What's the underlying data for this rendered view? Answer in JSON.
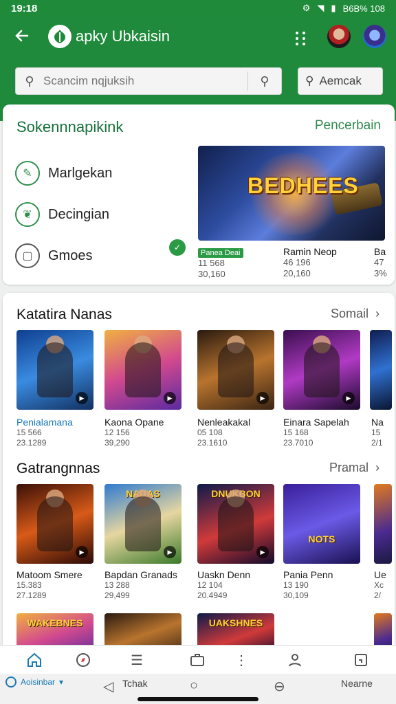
{
  "status": {
    "time": "19:18",
    "right_text": "B6B% 108"
  },
  "header": {
    "title": "apky Ubkaisin"
  },
  "search": {
    "placeholder": "Scancim nqjuksih",
    "secondary_label": "Aemcak"
  },
  "featured": {
    "title": "Sokennnapikink",
    "link": "Pencerbain",
    "categories": [
      {
        "label": "Marlgekan",
        "icon": "pencil-icon"
      },
      {
        "label": "Decingian",
        "icon": "leaf-icon"
      },
      {
        "label": "Gmoes",
        "icon": "window-icon"
      }
    ],
    "banner_logo": "BEDHEES",
    "items": [
      {
        "name": "Panea Deai",
        "n1": "11 568",
        "n2": "30,160"
      },
      {
        "name": "Ramin Neop",
        "n1": "46 196",
        "n2": "20,160"
      },
      {
        "name": "Ba",
        "n1": "47",
        "n2": "3%"
      }
    ]
  },
  "section1": {
    "title": "Katatira Nanas",
    "link": "Somail",
    "items": [
      {
        "name": "Penialamana",
        "n1": "15 566",
        "n2": "23.1289"
      },
      {
        "name": "Kaona Opane",
        "n1": "12 156",
        "n2": "39,290"
      },
      {
        "name": "Nenleakakal",
        "n1": "05 108",
        "n2": "23.1610"
      },
      {
        "name": "Einara Sapelah",
        "n1": "15 168",
        "n2": "23.7010"
      },
      {
        "name": "Na",
        "n1": "15",
        "n2": "2/1"
      }
    ]
  },
  "section2": {
    "title": "Gatrangnnas",
    "link": "Pramal",
    "items": [
      {
        "name": "Matoom Smere",
        "n1": "15.383",
        "n2": "27.1289"
      },
      {
        "name": "Bapdan Granads",
        "n1": "13 288",
        "n2": "29,499"
      },
      {
        "name": "Uaskn Denn",
        "n1": "12 104",
        "n2": "20.4949"
      },
      {
        "name": "Pania Penn",
        "n1": "13 190",
        "n2": "30,109"
      },
      {
        "name": "Ue",
        "n1": "Xc",
        "n2": "2/"
      }
    ],
    "tile_logos": [
      "",
      "NADAS",
      "DNUKBON",
      "NOTS"
    ]
  },
  "section3": {
    "tile_logos": [
      "WAKEBNES",
      "",
      "UAKSHNES"
    ]
  },
  "bottom_nav": [
    "home-icon",
    "compass-icon",
    "list-icon",
    "briefcase-icon",
    "more-vertical-icon",
    "person-icon",
    "calendar-icon"
  ],
  "system": {
    "account": "Aoisinbar",
    "back_text": "Tchak",
    "right_text": "Nearne"
  }
}
